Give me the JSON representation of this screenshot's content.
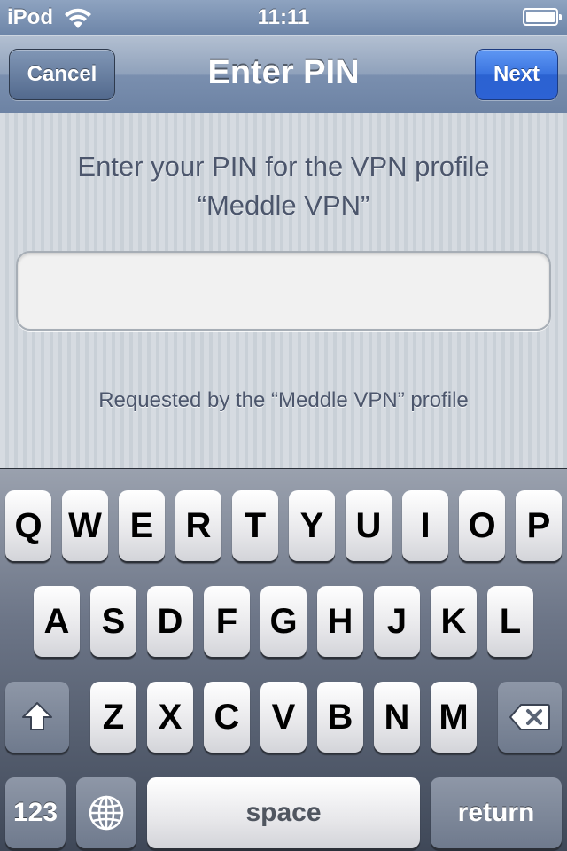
{
  "status_bar": {
    "carrier": "iPod",
    "time": "11:11",
    "wifi_icon": "wifi-icon",
    "battery_icon": "battery-icon"
  },
  "nav": {
    "title": "Enter PIN",
    "cancel_label": "Cancel",
    "next_label": "Next"
  },
  "content": {
    "prompt_line1": "Enter your PIN for the VPN profile",
    "prompt_line2": "“Meddle VPN”",
    "pin_value": "",
    "requested_by": "Requested by the “Meddle VPN” profile"
  },
  "keyboard": {
    "row1": [
      "Q",
      "W",
      "E",
      "R",
      "T",
      "Y",
      "U",
      "I",
      "O",
      "P"
    ],
    "row2": [
      "A",
      "S",
      "D",
      "F",
      "G",
      "H",
      "J",
      "K",
      "L"
    ],
    "row3": [
      "Z",
      "X",
      "C",
      "V",
      "B",
      "N",
      "M"
    ],
    "shift_icon": "shift-icon",
    "delete_icon": "delete-icon",
    "globe_icon": "globe-icon",
    "numbers_label": "123",
    "space_label": "space",
    "return_label": "return"
  },
  "colors": {
    "navbar": "#7a8faf",
    "next_button": "#3a73df",
    "content_bg": "#cbd2d8",
    "text": "#4c566c"
  }
}
